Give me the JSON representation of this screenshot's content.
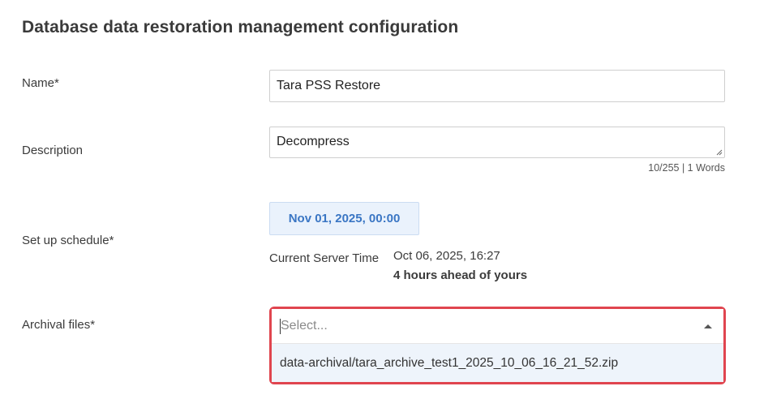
{
  "page": {
    "title": "Database data restoration management configuration"
  },
  "form": {
    "name": {
      "label": "Name*",
      "value": "Tara PSS Restore"
    },
    "description": {
      "label": "Description",
      "value": "Decompress",
      "counter": "10/255 | 1 Words"
    },
    "schedule": {
      "label": "Set up schedule*",
      "date_button": "Nov 01, 2025, 00:00",
      "server_time_label": "Current Server Time",
      "server_time_value": "Oct 06, 2025, 16:27",
      "server_time_offset": "4 hours ahead of yours"
    },
    "archival_files": {
      "label": "Archival files*",
      "placeholder": "Select...",
      "dropdown_open": true,
      "options": [
        "data-archival/tara_archive_test1_2025_10_06_16_21_52.zip"
      ]
    }
  },
  "colors": {
    "accent_blue": "#3a76c4",
    "highlight_red": "#e0454f",
    "option_hover": "#eef4fb"
  }
}
